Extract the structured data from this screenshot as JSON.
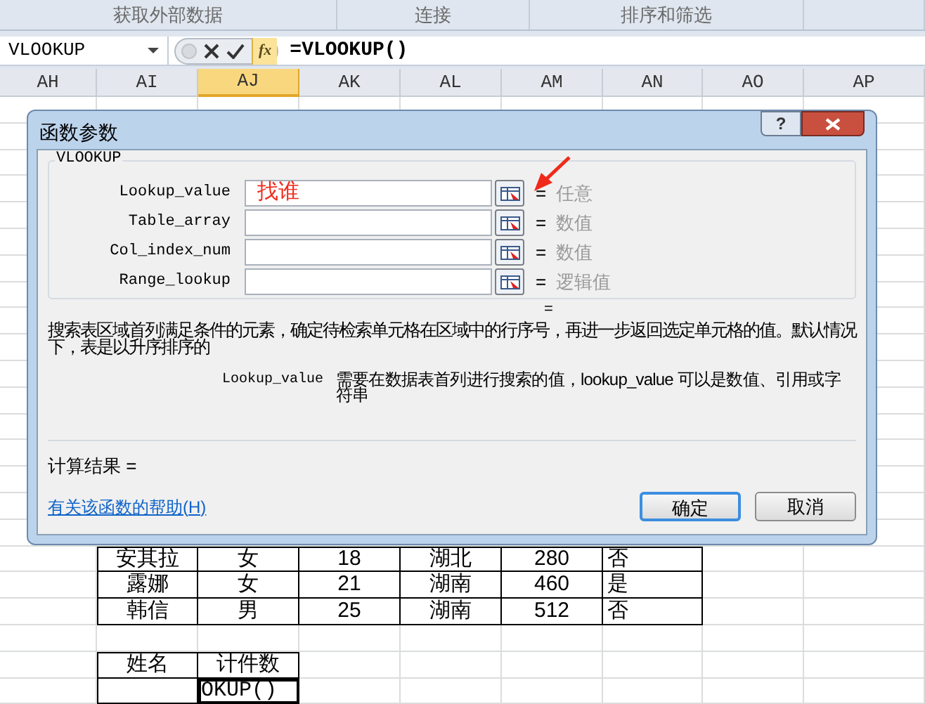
{
  "ribbon_groups": [
    "获取外部数据",
    "连接",
    "排序和筛选"
  ],
  "formula_bar": {
    "name_box": "VLOOKUP",
    "fx_label": "fx",
    "formula": "=VLOOKUP()"
  },
  "columns": [
    {
      "label": "AH",
      "selected": false
    },
    {
      "label": "AI",
      "selected": false
    },
    {
      "label": "AJ",
      "selected": true
    },
    {
      "label": "AK",
      "selected": false
    },
    {
      "label": "AL",
      "selected": false
    },
    {
      "label": "AM",
      "selected": false
    },
    {
      "label": "AN",
      "selected": false
    },
    {
      "label": "AO",
      "selected": false
    },
    {
      "label": "AP",
      "selected": false
    }
  ],
  "sheet": {
    "table_rows": [
      [
        "安其拉",
        "女",
        "18",
        "湖北",
        "280",
        "否"
      ],
      [
        "露娜",
        "女",
        "21",
        "湖南",
        "460",
        "是"
      ],
      [
        "韩信",
        "男",
        "25",
        "湖南",
        "512",
        "否"
      ]
    ],
    "summary_header": [
      "姓名",
      "计件数"
    ],
    "summary_formula": "OKUP()"
  },
  "dialog": {
    "title": "函数参数",
    "help_button": "?",
    "group_label": "VLOOKUP",
    "args": [
      {
        "name": "Lookup_value",
        "value": "找谁",
        "equals": "=",
        "hint": "任意"
      },
      {
        "name": "Table_array",
        "equals": "=",
        "hint": "数值"
      },
      {
        "name": "Col_index_num",
        "equals": "=",
        "hint": "数值"
      },
      {
        "name": "Range_lookup",
        "equals": "=",
        "hint": "逻辑值"
      }
    ],
    "result_equals": "=",
    "description": "搜索表区域首列满足条件的元素，确定待检索单元格在区域中的行序号，再进一步返回选定单元格的值。默认情况下，表是以升序排序的",
    "arg_name": "Lookup_value",
    "arg_description": "需要在数据表首列进行搜索的值，lookup_value 可以是数值、引用或字符串",
    "result_label": "计算结果 =",
    "help_link": "有关该函数的帮助(H)",
    "buttons": [
      {
        "label": "确定",
        "default": true
      },
      {
        "label": "取消",
        "default": false
      }
    ]
  }
}
